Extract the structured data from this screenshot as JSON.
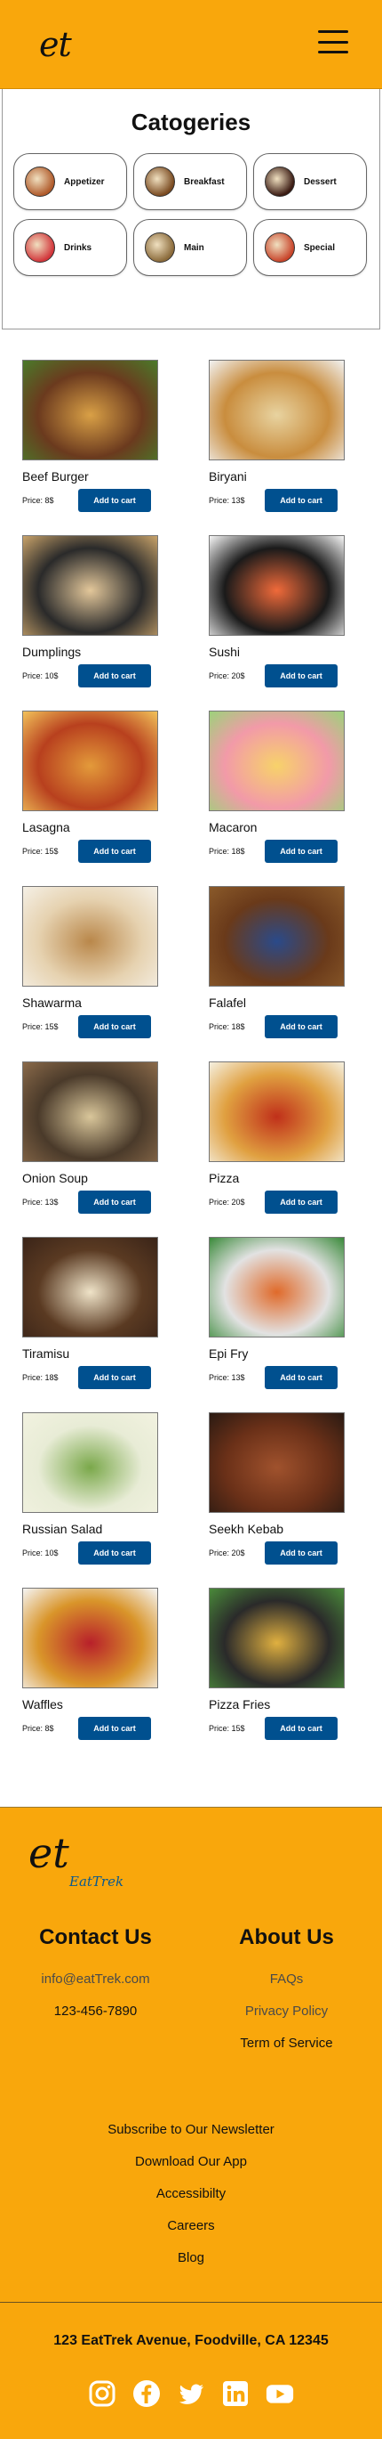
{
  "header": {
    "logo": "et"
  },
  "categories": {
    "title": "Catogeries",
    "items": [
      {
        "label": "Appetizer",
        "icon": "appetizer-icon",
        "color": "#b05a2a"
      },
      {
        "label": "Breakfast",
        "icon": "breakfast-icon",
        "color": "#7a4a20"
      },
      {
        "label": "Dessert",
        "icon": "dessert-icon",
        "color": "#3a1a12"
      },
      {
        "label": "Drinks",
        "icon": "drinks-icon",
        "color": "#d2353a"
      },
      {
        "label": "Main",
        "icon": "main-icon",
        "color": "#8a6a3a"
      },
      {
        "label": "Special",
        "icon": "special-icon",
        "color": "#c8442a"
      }
    ]
  },
  "products": [
    {
      "name": "Beef Burger",
      "price": "Price: 8$",
      "button": "Add to cart",
      "image": "burger-image",
      "colors": [
        "#6b3a1e",
        "#d9a046",
        "#4a7a2a"
      ]
    },
    {
      "name": "Biryani",
      "price": "Price: 13$",
      "button": "Add to cart",
      "image": "biryani-image",
      "colors": [
        "#c98d3e",
        "#e8d3a0",
        "#f2f2f2"
      ]
    },
    {
      "name": "Dumplings",
      "price": "Price: 10$",
      "button": "Add to cart",
      "image": "dumplings-image",
      "colors": [
        "#2a2a2a",
        "#e3c79a",
        "#c9a36a"
      ]
    },
    {
      "name": "Sushi",
      "price": "Price: 20$",
      "button": "Add to cart",
      "image": "sushi-image",
      "colors": [
        "#1a1a1a",
        "#f06a3a",
        "#f7f7f7"
      ]
    },
    {
      "name": "Lasagna",
      "price": "Price: 15$",
      "button": "Add to cart",
      "image": "lasagna-image",
      "colors": [
        "#b8401e",
        "#e39a3a",
        "#f2c25a"
      ]
    },
    {
      "name": "Macaron",
      "price": "Price: 18$",
      "button": "Add to cart",
      "image": "macaron-image",
      "colors": [
        "#f29aa8",
        "#f7d26a",
        "#9cd27a"
      ]
    },
    {
      "name": "Shawarma",
      "price": "Price: 15$",
      "button": "Add to cart",
      "image": "shawarma-image",
      "colors": [
        "#e6d2b0",
        "#b9874a",
        "#f5f0e6"
      ]
    },
    {
      "name": "Falafel",
      "price": "Price: 18$",
      "button": "Add to cart",
      "image": "falafel-image",
      "colors": [
        "#6a3a1a",
        "#2a4a8a",
        "#8a5a2a"
      ]
    },
    {
      "name": "Onion Soup",
      "price": "Price: 13$",
      "button": "Add to cart",
      "image": "onion-soup-image",
      "colors": [
        "#4a3a2a",
        "#d9c69a",
        "#8a6a4a"
      ]
    },
    {
      "name": "Pizza",
      "price": "Price: 20$",
      "button": "Add to cart",
      "image": "pizza-image",
      "colors": [
        "#e0a040",
        "#c0301a",
        "#f5f0e0"
      ]
    },
    {
      "name": "Tiramisu",
      "price": "Price: 18$",
      "button": "Add to cart",
      "image": "tiramisu-image",
      "colors": [
        "#5a3a22",
        "#efe3c8",
        "#3a2418"
      ]
    },
    {
      "name": "Epi Fry",
      "price": "Price: 13$",
      "button": "Add to cart",
      "image": "epi-fry-image",
      "colors": [
        "#e2e2e2",
        "#e06a2a",
        "#3a8a3a"
      ]
    },
    {
      "name": "Russian Salad",
      "price": "Price: 10$",
      "button": "Add to cart",
      "image": "russian-salad-image",
      "colors": [
        "#e8ecd6",
        "#7aa84a",
        "#f2f2e0"
      ]
    },
    {
      "name": "Seekh Kebab",
      "price": "Price: 20$",
      "button": "Add to cart",
      "image": "seekh-kebab-image",
      "colors": [
        "#6a3018",
        "#a0522d",
        "#2a1a12"
      ]
    },
    {
      "name": "Waffles",
      "price": "Price: 8$",
      "button": "Add to cart",
      "image": "waffles-image",
      "colors": [
        "#d9952a",
        "#b8202a",
        "#f5f5f5"
      ]
    },
    {
      "name": "Pizza Fries",
      "price": "Price: 15$",
      "button": "Add to cart",
      "image": "pizza-fries-image",
      "colors": [
        "#2a2a2a",
        "#e0b040",
        "#4a8a3a"
      ]
    }
  ],
  "footer": {
    "logo": "et",
    "brand": "EatTrek",
    "contact": {
      "title": "Contact Us",
      "email": "info@eatTrek.com",
      "phone": "123-456-7890"
    },
    "about": {
      "title": "About Us",
      "links": [
        "FAQs",
        "Privacy Policy",
        "Term of Service"
      ]
    },
    "list": [
      "Subscribe to Our Newsletter",
      "Download Our App",
      "Accessibilty",
      "Careers",
      "Blog"
    ],
    "address": "123 EatTrek Avenue, Foodville, CA 12345",
    "socials": [
      "instagram-icon",
      "facebook-icon",
      "twitter-icon",
      "linkedin-icon",
      "youtube-icon"
    ],
    "accent": "#f9a70c"
  }
}
